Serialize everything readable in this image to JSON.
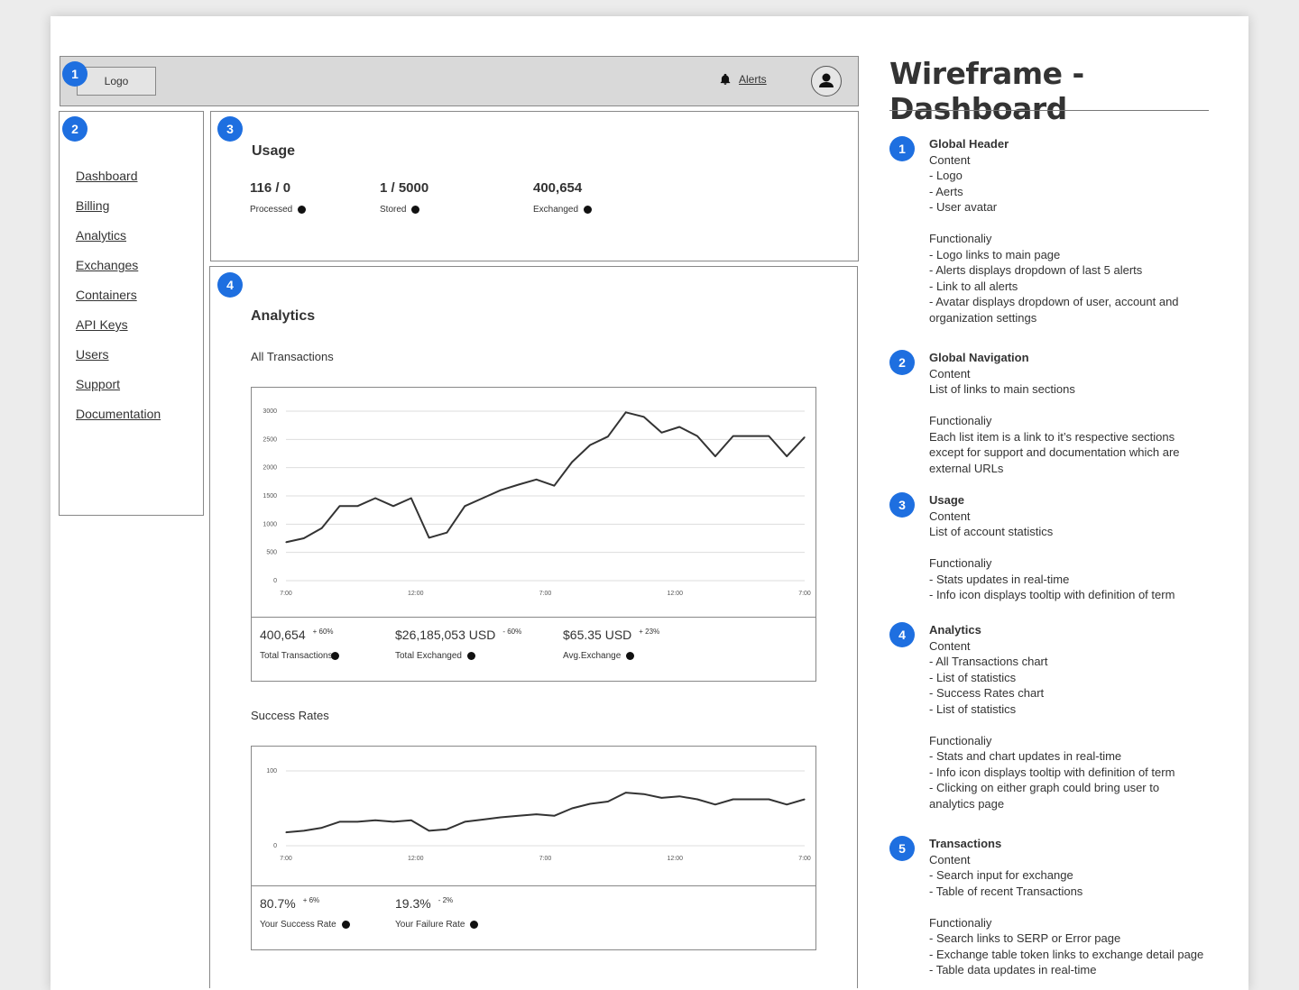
{
  "header": {
    "logo_label": "Logo",
    "alerts_label": "Alerts"
  },
  "sidenav": {
    "items": [
      "Dashboard",
      "Billing",
      "Analytics",
      "Exchanges",
      "Containers",
      "API Keys",
      "Users",
      "Support",
      "Documentation"
    ]
  },
  "usage": {
    "title": "Usage",
    "stats": [
      {
        "value": "116 / 0",
        "label": "Processed"
      },
      {
        "value": "1 / 5000",
        "label": "Stored"
      },
      {
        "value": "400,654",
        "label": "Exchanged"
      }
    ]
  },
  "analytics": {
    "title": "Analytics",
    "all_transactions_title": "All Transactions",
    "success_rates_title": "Success Rates",
    "kpis1": [
      {
        "value": "400,654",
        "delta": "+ 60%",
        "label": "Total Transactions"
      },
      {
        "value": "$26,185,053 USD",
        "delta": "- 60%",
        "label": "Total Exchanged"
      },
      {
        "value": "$65.35 USD",
        "delta": "+ 23%",
        "label": "Avg.Exchange"
      }
    ],
    "kpis2": [
      {
        "value": "80.7%",
        "delta": "+ 6%",
        "label": "Your Success Rate"
      },
      {
        "value": "19.3%",
        "delta": "- 2%",
        "label": "Your Failure Rate"
      }
    ]
  },
  "markers": [
    "1",
    "2",
    "3",
    "4",
    "5"
  ],
  "notes": {
    "title": "Wireframe - Dashboard",
    "items": [
      {
        "heading": "Global Header",
        "lines": [
          "Content",
          "- Logo",
          "- Aerts",
          "- User avatar",
          "",
          "Functionaliy",
          "- Logo links to main page",
          "- Alerts displays dropdown of last 5 alerts",
          "- Link to all alerts",
          "- Avatar displays dropdown of user, account and",
          "organization settings"
        ]
      },
      {
        "heading": "Global Navigation",
        "lines": [
          "Content",
          "List of links to main sections",
          "",
          "Functionaliy",
          "Each list item is a link to it’s respective sections",
          "except for support and documentation which are",
          "external URLs"
        ]
      },
      {
        "heading": "Usage",
        "lines": [
          "Content",
          "List of account statistics",
          "",
          "Functionaliy",
          "- Stats updates in real-time",
          "- Info icon displays tooltip with definition of term"
        ]
      },
      {
        "heading": "Analytics",
        "lines": [
          "Content",
          "- All Transactions chart",
          "- List of statistics",
          "- Success Rates chart",
          "- List of statistics",
          "",
          "Functionaliy",
          "- Stats and chart updates in real-time",
          "- Info icon displays tooltip with definition of term",
          "- Clicking on either graph could bring user to",
          "analytics page"
        ]
      },
      {
        "heading": "Transactions",
        "lines": [
          "Content",
          "- Search input for exchange",
          "- Table of recent Transactions",
          "",
          "Functionaliy",
          "- Search links to SERP or Error page",
          "- Exchange table token links to exchange detail page",
          "- Table data updates in real-time"
        ]
      }
    ]
  },
  "chart_data": [
    {
      "type": "line",
      "title": "All Transactions",
      "x_ticks": [
        "7:00",
        "12:00",
        "7:00",
        "12:00",
        "7:00"
      ],
      "y_ticks": [
        "0",
        "500",
        "1000",
        "1500",
        "2000",
        "2500",
        "3000"
      ],
      "ylim": [
        0,
        3000
      ],
      "values": [
        680,
        750,
        930,
        1320,
        1320,
        1460,
        1320,
        1460,
        760,
        850,
        1320,
        1460,
        1600,
        1700,
        1790,
        1680,
        2100,
        2400,
        2550,
        2980,
        2900,
        2620,
        2720,
        2560,
        2200,
        2560,
        2560,
        2560,
        2200,
        2540
      ]
    },
    {
      "type": "line",
      "title": "Success Rates",
      "x_ticks": [
        "7:00",
        "12:00",
        "7:00",
        "12:00",
        "7:00"
      ],
      "y_ticks": [
        "0",
        "100"
      ],
      "ylim": [
        0,
        100
      ],
      "values": [
        18,
        20,
        24,
        32,
        32,
        34,
        32,
        34,
        20,
        22,
        32,
        35,
        38,
        40,
        42,
        40,
        50,
        56,
        59,
        71,
        69,
        64,
        66,
        62,
        55,
        62,
        62,
        62,
        55,
        62
      ]
    }
  ]
}
